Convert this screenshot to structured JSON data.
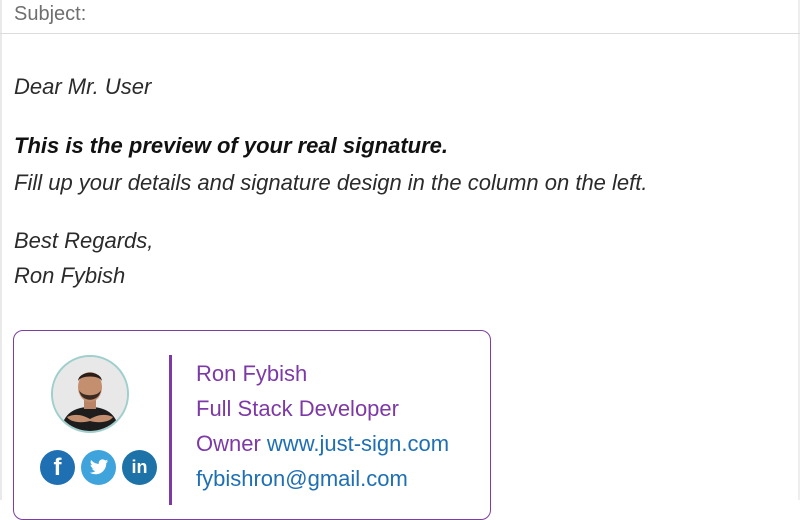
{
  "header": {
    "subject_label": "Subject:"
  },
  "message": {
    "greeting": "Dear Mr. User",
    "bold_line": "This is the preview of your real signature.",
    "instruction": "Fill up your details and signature design in the column on the left.",
    "closing": "Best Regards,",
    "sender": "Ron Fybish"
  },
  "signature": {
    "name": "Ron Fybish",
    "title": "Full Stack Developer",
    "role": "Owner",
    "website": "www.just-sign.com",
    "email": "fybishron@gmail.com",
    "accent_color": "#7d3aa6",
    "link_color": "#1f6fb3",
    "socials": [
      {
        "icon": "facebook-icon",
        "glyph": "f",
        "color": "#1f6fb3"
      },
      {
        "icon": "twitter-icon",
        "glyph": "t",
        "color": "#3fa3dc"
      },
      {
        "icon": "linkedin-icon",
        "glyph": "in",
        "color": "#1d73a8"
      }
    ]
  }
}
